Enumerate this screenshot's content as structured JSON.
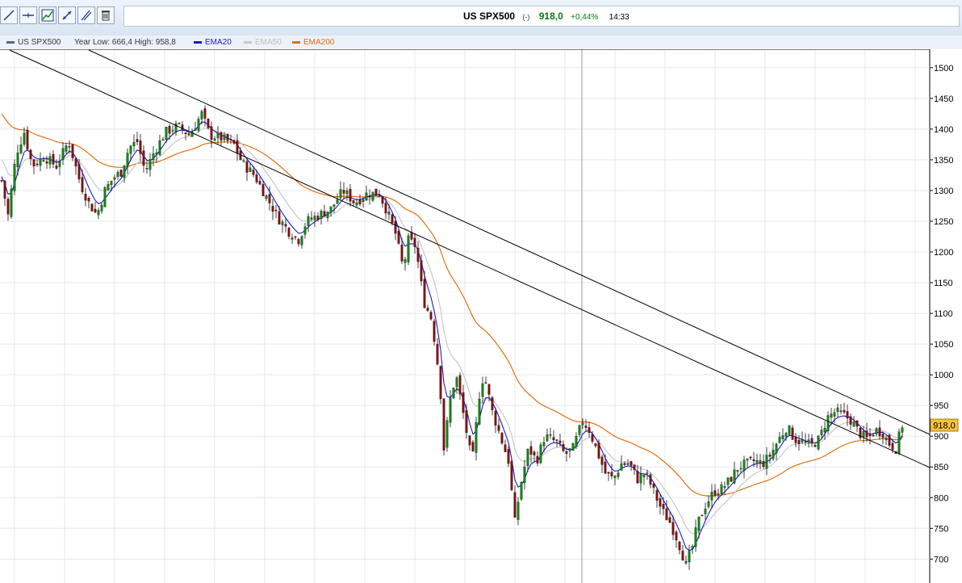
{
  "toolbar": {
    "tools": [
      {
        "name": "draw-line-icon"
      },
      {
        "name": "horizontal-line-icon"
      },
      {
        "name": "indicator-chart-icon"
      },
      {
        "name": "trend-arrows-icon"
      },
      {
        "name": "fibonacci-icon"
      },
      {
        "name": "trash-icon"
      }
    ]
  },
  "quote": {
    "symbol": "US SPX500",
    "marker": "(-)",
    "price": "918,0",
    "change": "+0,44%",
    "time": "14:33",
    "up_color": "#0a7a16"
  },
  "legend": {
    "main": "US SPX500",
    "range": "Year Low: 666,4 High: 958,8",
    "ema20": "EMA20",
    "ema50": "EMA50",
    "ema200": "EMA200"
  },
  "colors": {
    "ema20": "#1a1ac8",
    "ema50": "#c8c8c8",
    "ema200": "#e07010",
    "bull": "#0a8a0a",
    "bear": "#8b0a0a",
    "price_tag": "#f7c23b"
  },
  "chart_data": {
    "type": "candlestick",
    "y_ticks": [
      700,
      750,
      800,
      850,
      900,
      950,
      1000,
      1050,
      1100,
      1150,
      1200,
      1250,
      1300,
      1350,
      1400,
      1450,
      1500
    ],
    "ylim": [
      661,
      1530
    ],
    "grid": true,
    "last_price_label": "918,0",
    "last_price": 918.0,
    "close_path": [
      [
        0,
        1330
      ],
      [
        10,
        1260
      ],
      [
        20,
        1360
      ],
      [
        30,
        1395
      ],
      [
        40,
        1340
      ],
      [
        55,
        1355
      ],
      [
        70,
        1340
      ],
      [
        85,
        1380
      ],
      [
        100,
        1310
      ],
      [
        110,
        1280
      ],
      [
        120,
        1260
      ],
      [
        130,
        1300
      ],
      [
        140,
        1320
      ],
      [
        150,
        1330
      ],
      [
        160,
        1370
      ],
      [
        170,
        1380
      ],
      [
        180,
        1330
      ],
      [
        190,
        1360
      ],
      [
        205,
        1395
      ],
      [
        220,
        1405
      ],
      [
        235,
        1390
      ],
      [
        250,
        1425
      ],
      [
        260,
        1390
      ],
      [
        275,
        1385
      ],
      [
        290,
        1375
      ],
      [
        300,
        1345
      ],
      [
        315,
        1325
      ],
      [
        330,
        1290
      ],
      [
        345,
        1255
      ],
      [
        360,
        1230
      ],
      [
        370,
        1220
      ],
      [
        380,
        1250
      ],
      [
        395,
        1260
      ],
      [
        410,
        1270
      ],
      [
        425,
        1300
      ],
      [
        440,
        1280
      ],
      [
        455,
        1295
      ],
      [
        470,
        1295
      ],
      [
        480,
        1265
      ],
      [
        490,
        1230
      ],
      [
        500,
        1170
      ],
      [
        505,
        1220
      ],
      [
        515,
        1210
      ],
      [
        525,
        1120
      ],
      [
        535,
        1090
      ],
      [
        545,
        990
      ],
      [
        550,
        880
      ],
      [
        558,
        960
      ],
      [
        565,
        1000
      ],
      [
        575,
        930
      ],
      [
        585,
        855
      ],
      [
        595,
        980
      ],
      [
        600,
        1000
      ],
      [
        610,
        940
      ],
      [
        620,
        900
      ],
      [
        630,
        860
      ],
      [
        638,
        760
      ],
      [
        645,
        820
      ],
      [
        655,
        880
      ],
      [
        665,
        860
      ],
      [
        675,
        900
      ],
      [
        690,
        890
      ],
      [
        700,
        870
      ],
      [
        710,
        880
      ],
      [
        722,
        925
      ],
      [
        730,
        910
      ],
      [
        740,
        875
      ],
      [
        750,
        840
      ],
      [
        760,
        830
      ],
      [
        770,
        855
      ],
      [
        780,
        855
      ],
      [
        790,
        830
      ],
      [
        800,
        840
      ],
      [
        810,
        810
      ],
      [
        820,
        780
      ],
      [
        830,
        760
      ],
      [
        840,
        730
      ],
      [
        850,
        690
      ],
      [
        858,
        720
      ],
      [
        865,
        760
      ],
      [
        875,
        790
      ],
      [
        885,
        810
      ],
      [
        895,
        815
      ],
      [
        905,
        830
      ],
      [
        915,
        850
      ],
      [
        925,
        855
      ],
      [
        935,
        860
      ],
      [
        945,
        855
      ],
      [
        955,
        870
      ],
      [
        965,
        895
      ],
      [
        975,
        915
      ],
      [
        985,
        895
      ],
      [
        995,
        890
      ],
      [
        1005,
        885
      ],
      [
        1015,
        895
      ],
      [
        1025,
        930
      ],
      [
        1035,
        940
      ],
      [
        1045,
        935
      ],
      [
        1055,
        925
      ],
      [
        1065,
        905
      ],
      [
        1075,
        895
      ],
      [
        1085,
        910
      ],
      [
        1095,
        905
      ],
      [
        1100,
        890
      ],
      [
        1110,
        880
      ],
      [
        1118,
        918
      ]
    ]
  }
}
